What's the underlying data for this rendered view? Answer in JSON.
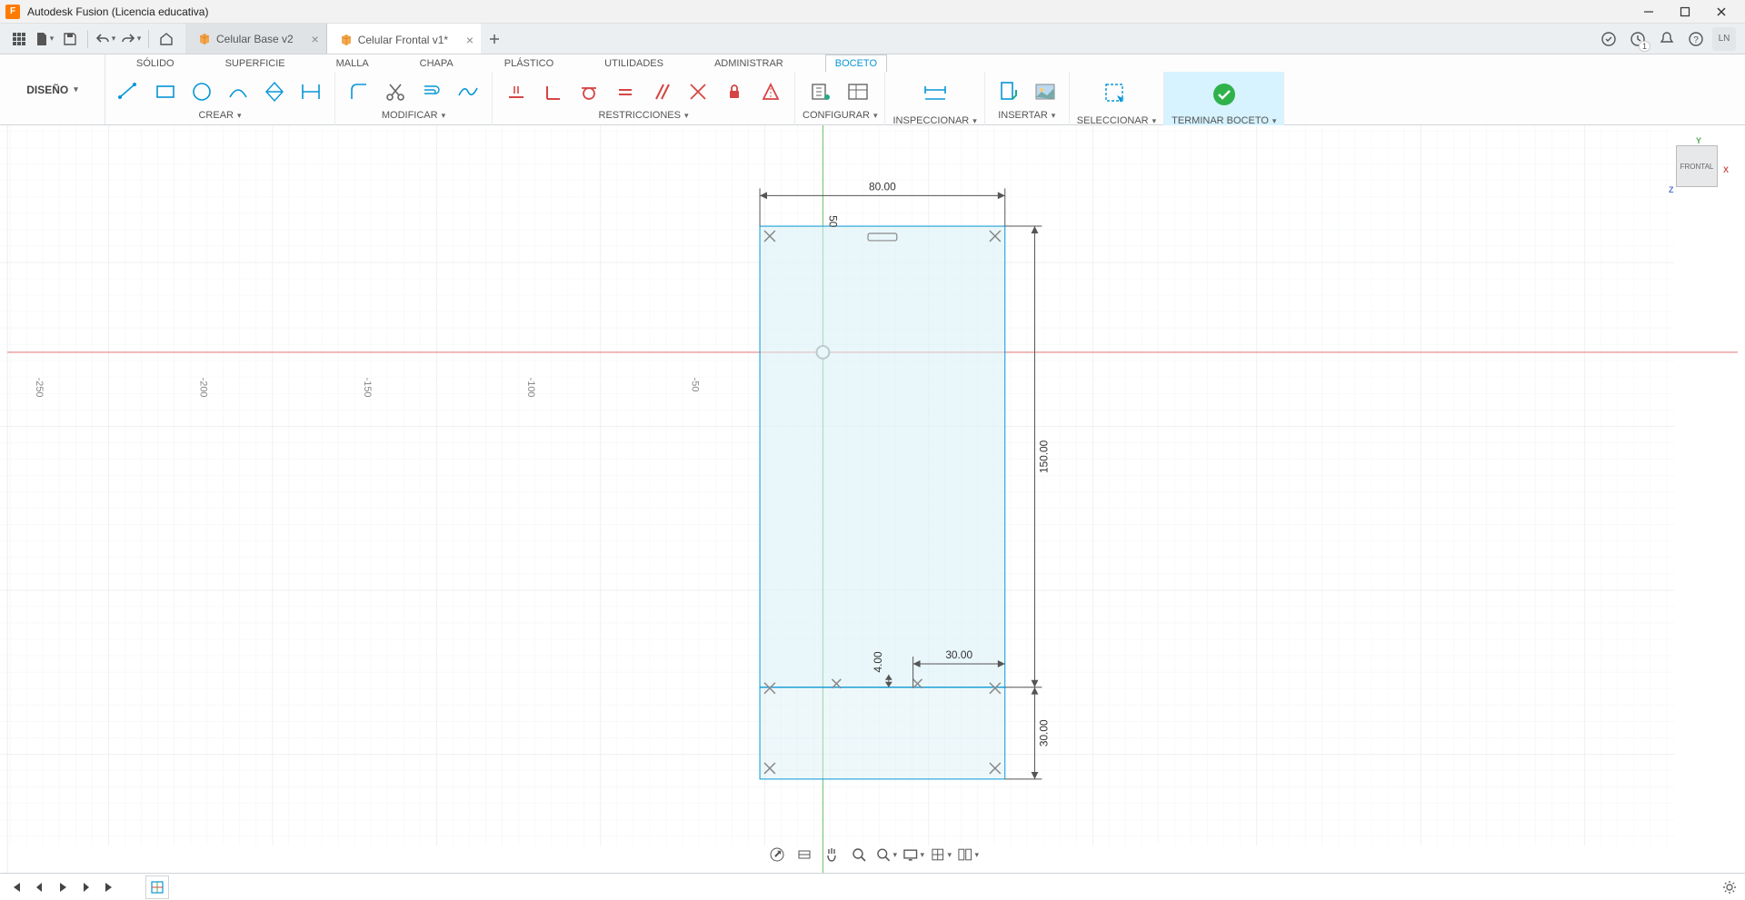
{
  "window": {
    "title": "Autodesk Fusion (Licencia educativa)"
  },
  "qat": {
    "home_tip": "Inicio"
  },
  "tabs": [
    {
      "label": "Celular Base v2",
      "active": false
    },
    {
      "label": "Celular Frontal v1*",
      "active": true
    }
  ],
  "header": {
    "job_count": "1",
    "user_initials": "LN"
  },
  "workspace": {
    "label": "DISEÑO"
  },
  "ribbon_tabs": {
    "items": [
      "SÓLIDO",
      "SUPERFICIE",
      "MALLA",
      "CHAPA",
      "PLÁSTICO",
      "UTILIDADES",
      "ADMINISTRAR",
      "BOCETO"
    ],
    "active_index": 7
  },
  "panels": {
    "create": "CREAR",
    "modify": "MODIFICAR",
    "constraints": "RESTRICCIONES",
    "configure": "CONFIGURAR",
    "inspect": "INSPECCIONAR",
    "insert": "INSERTAR",
    "select": "SELECCIONAR",
    "finish": "TERMINAR BOCETO"
  },
  "viewcube": {
    "face": "FRONTAL",
    "x": "X",
    "y": "Y",
    "z": "Z"
  },
  "ruler": {
    "ticks": [
      "-250",
      "-200",
      "-150",
      "-100",
      "-50"
    ]
  },
  "sketch": {
    "dim_width": "80.00",
    "dim_half": "50",
    "dim_height": "150.00",
    "dim_notch_w": "30.00",
    "dim_notch_h": "4.00",
    "dim_bottom": "30.00"
  }
}
